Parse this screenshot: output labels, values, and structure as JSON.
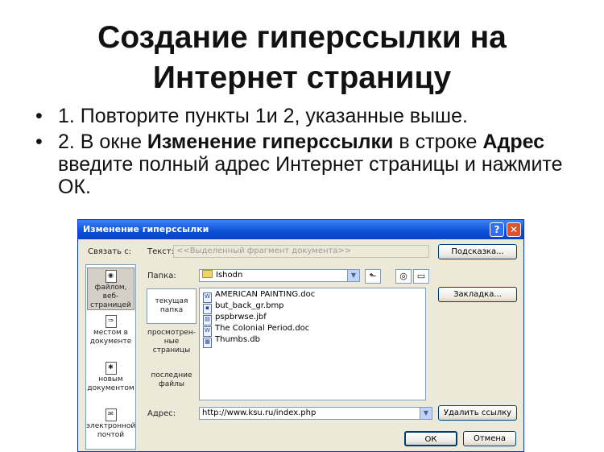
{
  "slide": {
    "title_line1": "Создание гиперссылки на",
    "title_line2": "Интернет страницу",
    "bullet1": "1. Повторите пункты 1и 2, указанные выше.",
    "bullet2_pre": "2. В окне ",
    "bullet2_bold1": "Изменение гиперссылки",
    "bullet2_mid": " в строке ",
    "bullet2_bold2": "Адрес",
    "bullet2_post": " введите полный адрес Интернет страницы и нажмите ОК."
  },
  "dialog": {
    "title": "Изменение гиперссылки",
    "help_glyph": "?",
    "close_glyph": "✕",
    "link_to_label": "Связать с:",
    "text_label": "Текст:",
    "text_value": "<<Выделенный фрагмент документа>>",
    "hint_button": "Подсказка...",
    "folder_label": "Папка:",
    "folder_value": "Ishodn",
    "bookmark_button": "Закладка...",
    "address_label": "Адрес:",
    "address_value": "http://www.ksu.ru/index.php",
    "remove_link_button": "Удалить ссылку",
    "ok_button": "ОК",
    "cancel_button": "Отмена",
    "link_to_items": [
      {
        "label": "файлом, веб-страницей",
        "icon": "web-page-icon",
        "active": true
      },
      {
        "label": "местом в документе",
        "icon": "place-in-document-icon",
        "active": false
      },
      {
        "label": "новым документом",
        "icon": "new-document-icon",
        "active": false
      },
      {
        "label": "электронной почтой",
        "icon": "email-icon",
        "active": false
      }
    ],
    "browse_items": [
      {
        "label": "текущая папка",
        "active": true
      },
      {
        "label": "просмотрен-ные страницы",
        "active": false
      },
      {
        "label": "последние файлы",
        "active": false
      }
    ],
    "files": [
      {
        "name": "AMERICAN PAINTING.doc",
        "icon": "word-document-icon"
      },
      {
        "name": "but_back_gr.bmp",
        "icon": "bitmap-icon"
      },
      {
        "name": "pspbrwse.jbf",
        "icon": "generic-file-icon"
      },
      {
        "name": "The Colonial Period.doc",
        "icon": "word-document-icon"
      },
      {
        "name": "Thumbs.db",
        "icon": "database-icon"
      }
    ],
    "accent_color": "#0a4fd6"
  }
}
